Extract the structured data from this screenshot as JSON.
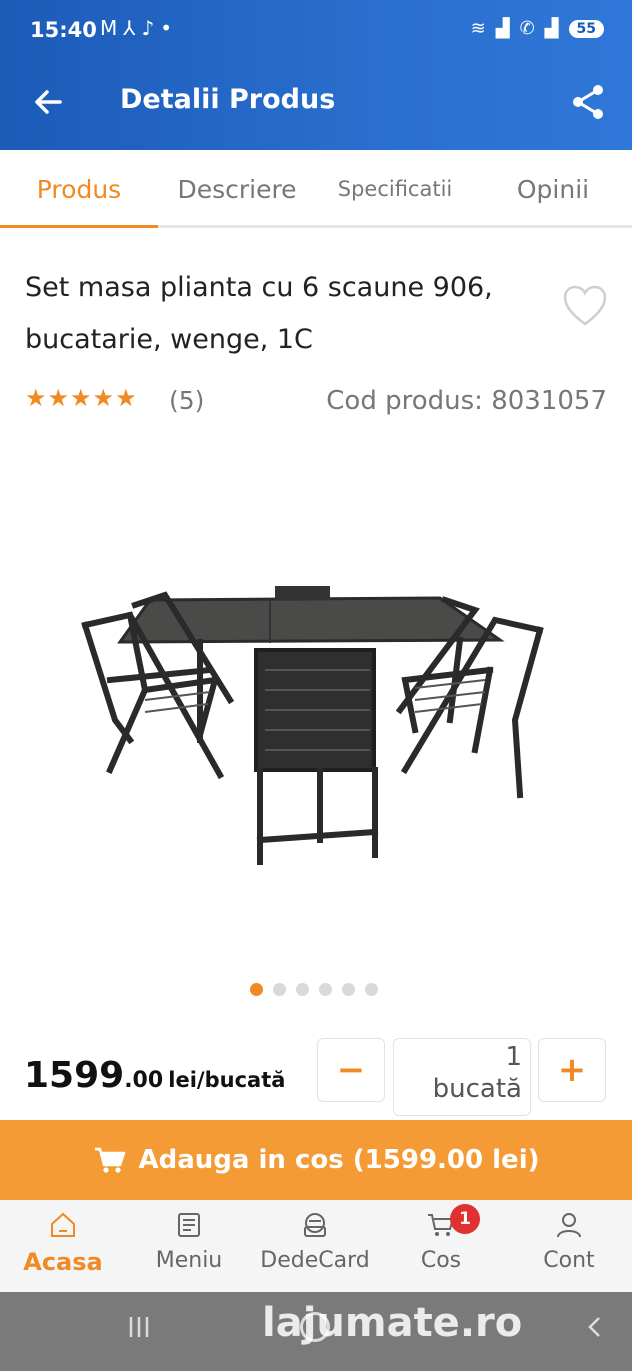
{
  "status_bar": {
    "time": "15:40",
    "left_icons": [
      "gmail-icon",
      "app-icon",
      "tiktok-icon",
      "dot-icon"
    ],
    "right_icons": [
      "wifi-icon",
      "signal-icon",
      "call-icon",
      "signal-icon"
    ],
    "battery": "55"
  },
  "header": {
    "title": "Detalii Produs",
    "bg_color": "#1c5bb8"
  },
  "tabs": [
    {
      "label": "Produs",
      "active": true
    },
    {
      "label": "Descriere",
      "active": false
    },
    {
      "label": "Specificatii",
      "active": false
    },
    {
      "label": "Opinii",
      "active": false
    }
  ],
  "product": {
    "title": "Set masa plianta cu 6 scaune 906, bucatarie, wenge, 1C",
    "stars": "★★★★★",
    "rating": 5,
    "review_count": "(5)",
    "code_text": "Cod produs: 8031057",
    "image_count": 6,
    "active_image": 1
  },
  "price": {
    "integer": "1599",
    "decimals": ".00",
    "unit": "lei/bucată"
  },
  "quantity": {
    "minus": "−",
    "value": "1",
    "unit": "bucată",
    "plus": "+"
  },
  "cart_button": {
    "label": "Adauga in cos (1599.00 lei)",
    "color": "#f59b35"
  },
  "bottom_nav": [
    {
      "label": "Acasa",
      "icon": "home-icon",
      "active": true
    },
    {
      "label": "Meniu",
      "icon": "menu-list-icon",
      "active": false
    },
    {
      "label": "DedeCard",
      "icon": "card-icon",
      "active": false
    },
    {
      "label": "Cos",
      "icon": "cart-icon",
      "active": false,
      "badge": "1"
    },
    {
      "label": "Cont",
      "icon": "user-icon",
      "active": false
    }
  ],
  "watermark": "lajumate.ro",
  "accent_color": "#f08a24"
}
